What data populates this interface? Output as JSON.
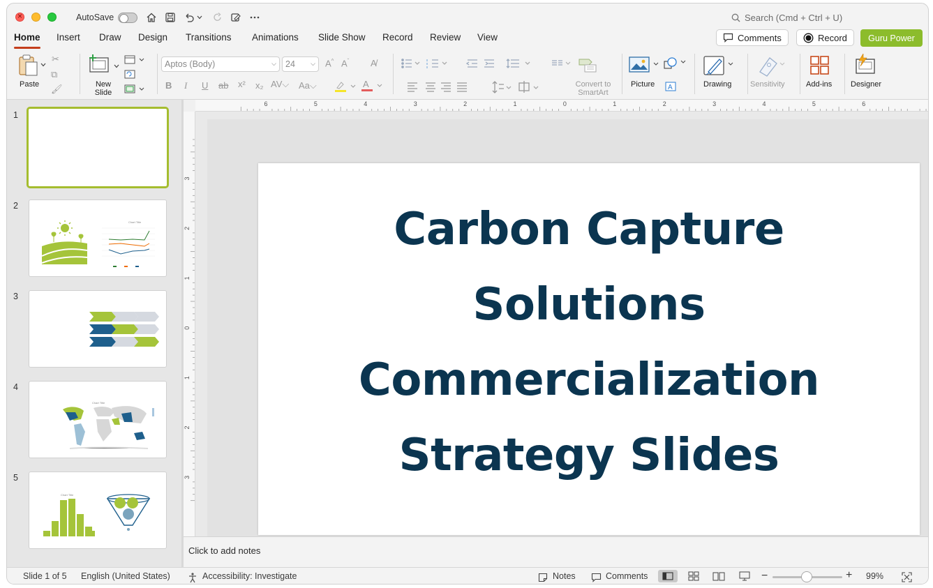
{
  "titlebar": {
    "autosave_label": "AutoSave",
    "search_placeholder": "Search (Cmd + Ctrl + U)"
  },
  "tabs": [
    {
      "label": "Home",
      "active": true
    },
    {
      "label": "Insert"
    },
    {
      "label": "Draw"
    },
    {
      "label": "Design"
    },
    {
      "label": "Transitions"
    },
    {
      "label": "Animations"
    },
    {
      "label": "Slide Show"
    },
    {
      "label": "Record"
    },
    {
      "label": "Review"
    },
    {
      "label": "View"
    }
  ],
  "header_buttons": {
    "comments": "Comments",
    "record": "Record",
    "guru": "Guru Power"
  },
  "ribbon": {
    "paste": "Paste",
    "new_slide": "New Slide",
    "font_name": "Aptos (Body)",
    "font_size": "24",
    "convert_smartart": "Convert to SmartArt",
    "picture": "Picture",
    "drawing": "Drawing",
    "sensitivity": "Sensitivity",
    "addins": "Add-ins",
    "designer": "Designer"
  },
  "thumbnails": [
    {
      "number": "1",
      "selected": true
    },
    {
      "number": "2"
    },
    {
      "number": "3"
    },
    {
      "number": "4"
    },
    {
      "number": "5"
    }
  ],
  "rulers": {
    "horizontal": [
      "6",
      "5",
      "4",
      "3",
      "2",
      "1",
      "0",
      "1",
      "2",
      "3",
      "4",
      "5",
      "6"
    ],
    "vertical": [
      "3",
      "2",
      "1",
      "0",
      "1",
      "2",
      "3"
    ]
  },
  "slide": {
    "title_lines": [
      "Carbon Capture",
      "Solutions",
      "Commercialization",
      "Strategy Slides"
    ],
    "title_color": "#0b3550"
  },
  "notes_placeholder": "Click to add notes",
  "status": {
    "slide_count": "Slide 1 of 5",
    "language": "English (United States)",
    "accessibility": "Accessibility: Investigate",
    "notes": "Notes",
    "comments": "Comments",
    "zoom": "99%"
  },
  "colors": {
    "accent_green": "#8cbc2c",
    "tab_underline": "#c43e1c",
    "navy": "#0b3550"
  }
}
